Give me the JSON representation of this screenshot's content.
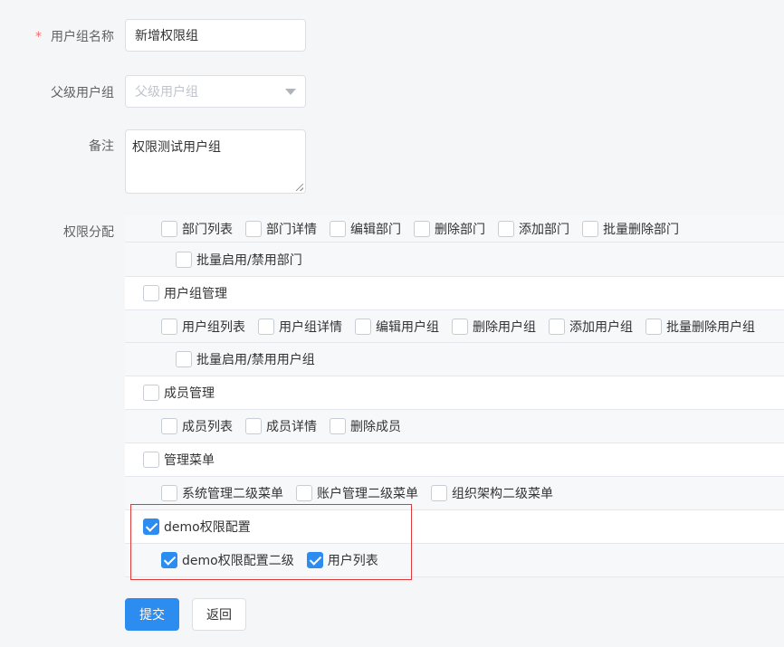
{
  "form": {
    "name_required_mark": "*",
    "name_label": "用户组名称",
    "name_value": "新增权限组",
    "parent_label": "父级用户组",
    "parent_placeholder": "父级用户组",
    "remark_label": "备注",
    "remark_value": "权限测试用户组",
    "perm_label": "权限分配"
  },
  "tree": [
    {
      "level": 1,
      "items": [
        {
          "label": "部门列表",
          "checked": false
        },
        {
          "label": "部门详情",
          "checked": false
        },
        {
          "label": "编辑部门",
          "checked": false
        },
        {
          "label": "删除部门",
          "checked": false
        },
        {
          "label": "添加部门",
          "checked": false
        },
        {
          "label": "批量删除部门",
          "checked": false
        }
      ]
    },
    {
      "level": 2,
      "items": [
        {
          "label": "批量启用/禁用部门",
          "checked": false
        }
      ]
    },
    {
      "level": 0,
      "items": [
        {
          "label": "用户组管理",
          "checked": false
        }
      ]
    },
    {
      "level": 1,
      "items": [
        {
          "label": "用户组列表",
          "checked": false
        },
        {
          "label": "用户组详情",
          "checked": false
        },
        {
          "label": "编辑用户组",
          "checked": false
        },
        {
          "label": "删除用户组",
          "checked": false
        },
        {
          "label": "添加用户组",
          "checked": false
        },
        {
          "label": "批量删除用户组",
          "checked": false
        }
      ]
    },
    {
      "level": 2,
      "items": [
        {
          "label": "批量启用/禁用用户组",
          "checked": false
        }
      ]
    },
    {
      "level": 0,
      "items": [
        {
          "label": "成员管理",
          "checked": false
        }
      ]
    },
    {
      "level": 1,
      "items": [
        {
          "label": "成员列表",
          "checked": false
        },
        {
          "label": "成员详情",
          "checked": false
        },
        {
          "label": "删除成员",
          "checked": false
        }
      ]
    },
    {
      "level": 0,
      "items": [
        {
          "label": "管理菜单",
          "checked": false
        }
      ]
    },
    {
      "level": 1,
      "items": [
        {
          "label": "系统管理二级菜单",
          "checked": false
        },
        {
          "label": "账户管理二级菜单",
          "checked": false
        },
        {
          "label": "组织架构二级菜单",
          "checked": false
        }
      ]
    },
    {
      "level": 0,
      "items": [
        {
          "label": "demo权限配置",
          "checked": true
        }
      ]
    },
    {
      "level": 1,
      "items": [
        {
          "label": "demo权限配置二级",
          "checked": true
        },
        {
          "label": "用户列表",
          "checked": true
        }
      ]
    }
  ],
  "buttons": {
    "submit": "提交",
    "back": "返回"
  },
  "colors": {
    "primary": "#2d8cf0",
    "highlight_border": "#e03a3a"
  }
}
